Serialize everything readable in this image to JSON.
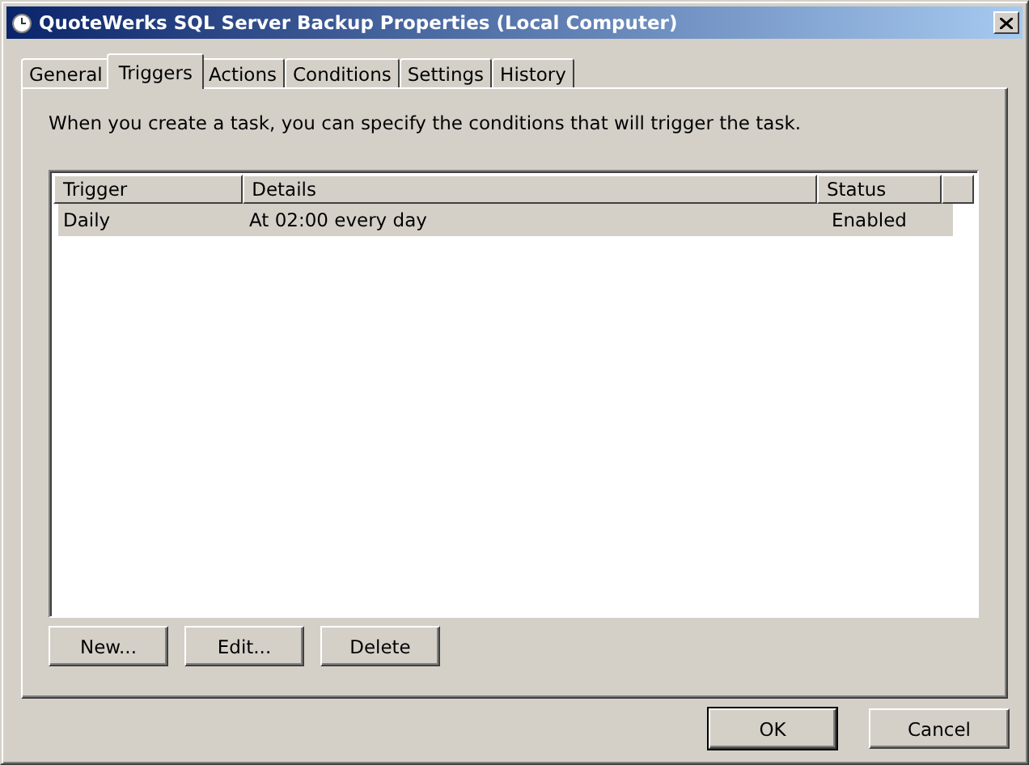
{
  "window": {
    "title": "QuoteWerks SQL Server Backup Properties (Local Computer)"
  },
  "tabs": [
    {
      "label": "General",
      "selected": false
    },
    {
      "label": "Triggers",
      "selected": true
    },
    {
      "label": "Actions",
      "selected": false
    },
    {
      "label": "Conditions",
      "selected": false
    },
    {
      "label": "Settings",
      "selected": false
    },
    {
      "label": "History",
      "selected": false
    }
  ],
  "description": "When you create a task, you can specify the conditions that will trigger the task.",
  "table": {
    "columns": [
      "Trigger",
      "Details",
      "Status"
    ],
    "rows": [
      {
        "cells": [
          "Daily",
          "At 02:00 every day",
          "Enabled"
        ],
        "selected": true
      }
    ]
  },
  "list_buttons": [
    "New...",
    "Edit...",
    "Delete"
  ],
  "dialog_buttons": [
    {
      "label": "OK",
      "default": true
    },
    {
      "label": "Cancel",
      "default": false
    }
  ]
}
